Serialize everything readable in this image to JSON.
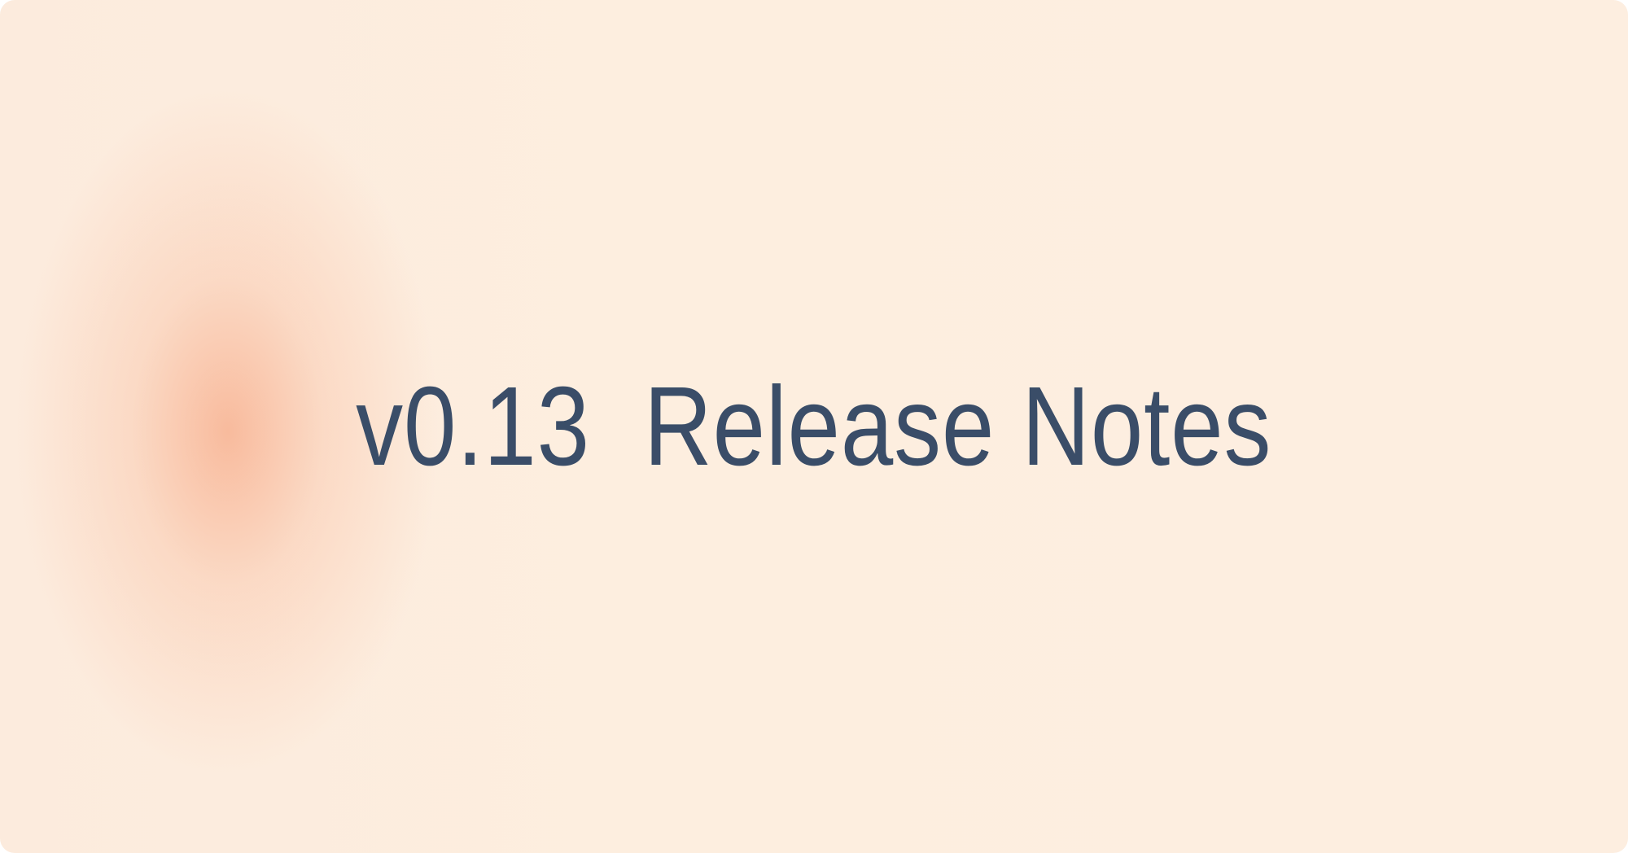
{
  "title": "v0.13  Release Notes",
  "colors": {
    "text": "#3a4d68",
    "background": "#fdeee0",
    "glow": "#f7aa87"
  }
}
